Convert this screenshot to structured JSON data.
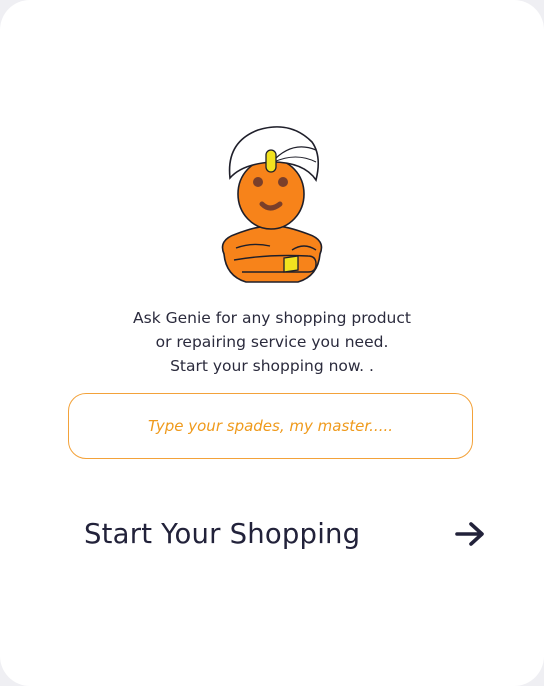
{
  "intro": {
    "line1": "Ask Genie for any shopping product",
    "line2": "or repairing service you need.",
    "line3": "Start your shopping now. ."
  },
  "search": {
    "placeholder": "Type your spades, my master.....",
    "value": ""
  },
  "cta": {
    "label": "Start Your Shopping",
    "icon": "arrow-right-icon"
  },
  "mascot": {
    "icon": "genie-icon"
  },
  "colors": {
    "accent": "#F39A1E",
    "skin": "#F7831A",
    "text": "#22223A",
    "jewel": "#F2E21F"
  }
}
